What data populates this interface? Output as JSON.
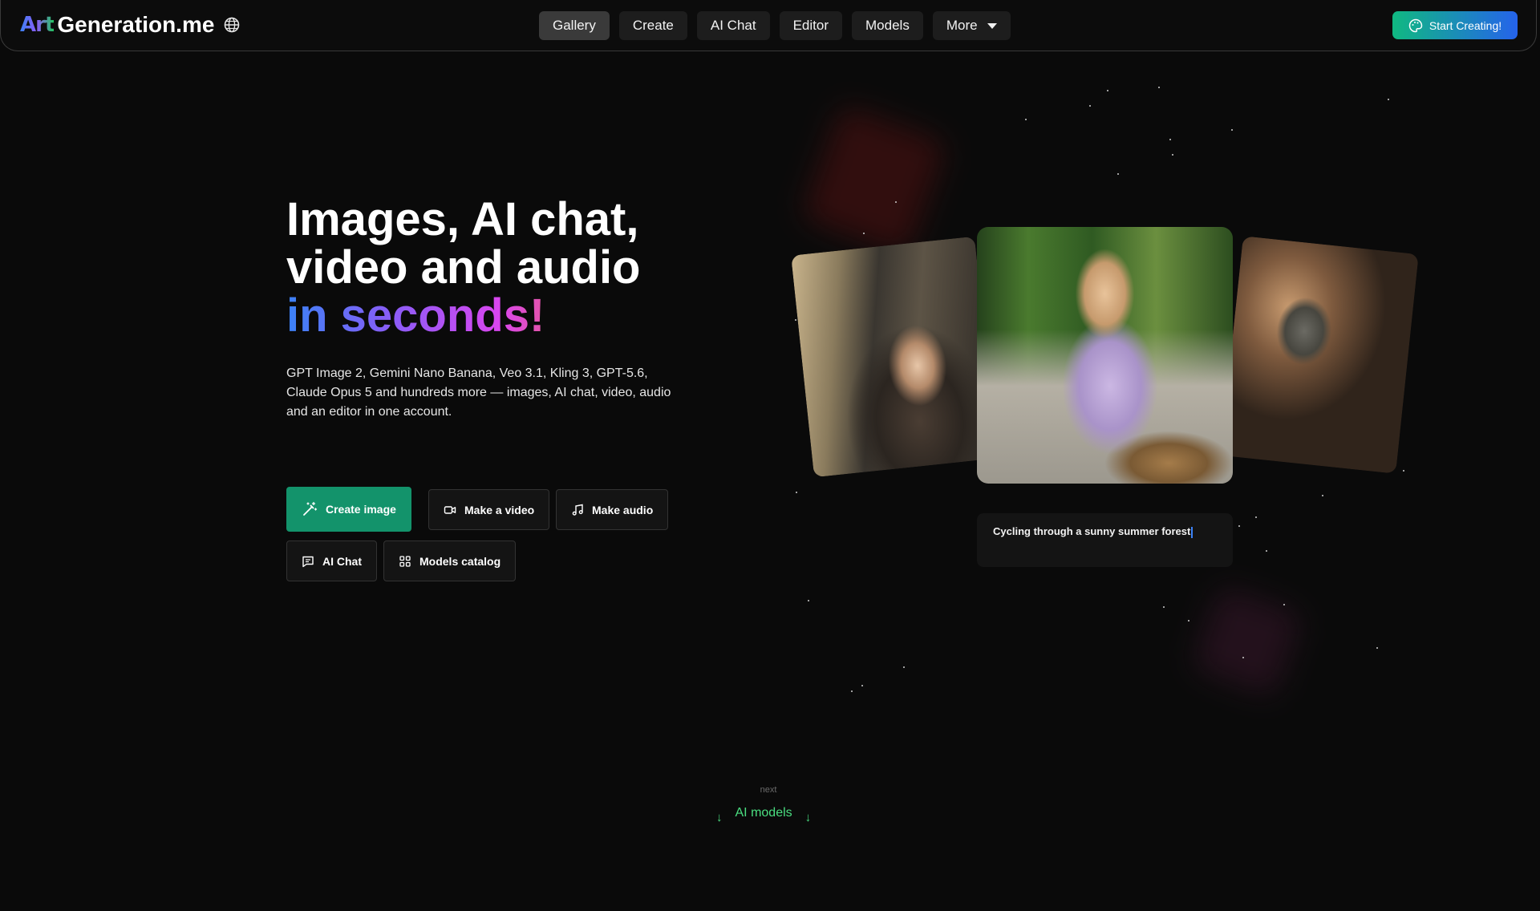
{
  "header": {
    "logo_art": "Art",
    "logo_text": "Generation.me",
    "nav": [
      {
        "label": "Gallery"
      },
      {
        "label": "Create"
      },
      {
        "label": "AI Chat"
      },
      {
        "label": "Editor"
      },
      {
        "label": "Models"
      },
      {
        "label": "More"
      }
    ],
    "start_label": "Start Creating!"
  },
  "hero": {
    "line1": "Images, AI chat,",
    "line2": "video and audio",
    "line3": "in seconds!",
    "subtext": "GPT Image 2, Gemini Nano Banana, Veo 3.1, Kling 3, GPT-5.6, Claude Opus 5 and hundreds more — images, AI chat, video, audio and an editor in one account.",
    "buttons": {
      "create_image": "Create image",
      "make_video": "Make a video",
      "make_audio": "Make audio",
      "ai_chat": "AI Chat",
      "models_catalog": "Models catalog"
    }
  },
  "gallery": {
    "caption": "Cycling through a sunny summer forest"
  },
  "next": {
    "label": "next",
    "link": "AI models"
  },
  "colors": {
    "accent_green": "#13936b",
    "cta_gradient_start": "#10b981",
    "cta_gradient_end": "#2563eb",
    "link_green": "#4ade80"
  }
}
